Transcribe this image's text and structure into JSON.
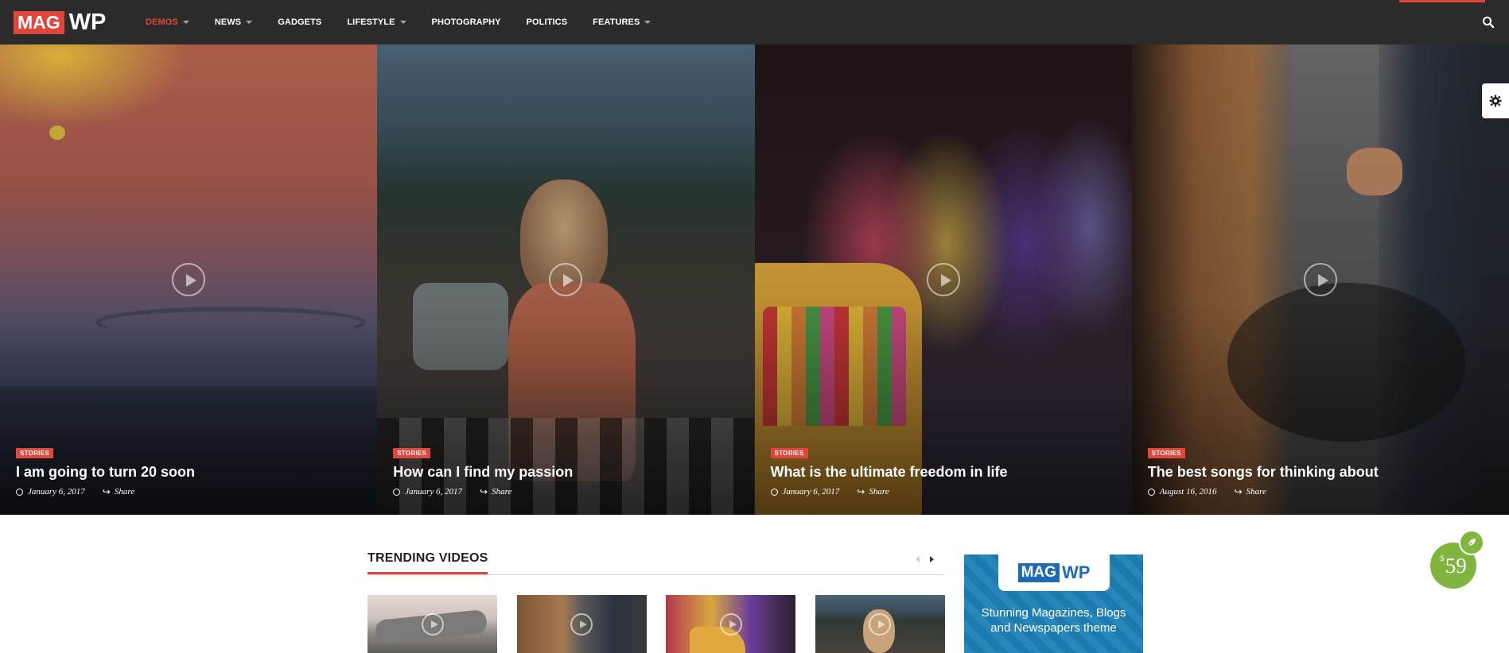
{
  "header": {
    "logo": {
      "part1": "MAG",
      "part2": "WP"
    },
    "nav": [
      {
        "label": "DEMOS",
        "dropdown": true,
        "active": true
      },
      {
        "label": "NEWS",
        "dropdown": true
      },
      {
        "label": "GADGETS",
        "dropdown": false
      },
      {
        "label": "LIFESTYLE",
        "dropdown": true
      },
      {
        "label": "PHOTOGRAPHY",
        "dropdown": false
      },
      {
        "label": "POLITICS",
        "dropdown": false
      },
      {
        "label": "FEATURES",
        "dropdown": true
      }
    ],
    "search_icon": "search-icon"
  },
  "hero": [
    {
      "category": "STORIES",
      "title": "I am going to turn 20 soon",
      "date": "January 6, 2017",
      "share": "Share"
    },
    {
      "category": "STORIES",
      "title": "How can I find my passion",
      "date": "January 6, 2017",
      "share": "Share"
    },
    {
      "category": "STORIES",
      "title": "What is the ultimate freedom in life",
      "date": "January 6, 2017",
      "share": "Share"
    },
    {
      "category": "STORIES",
      "title": "The best songs for thinking about",
      "date": "August 16, 2016",
      "share": "Share"
    }
  ],
  "trending": {
    "title": "TRENDING VIDEOS"
  },
  "ad": {
    "logo_part1": "MAG",
    "logo_part2": "WP",
    "line1": "Stunning Magazines, Blogs",
    "line2": "and Newspapers theme"
  },
  "price_badge": {
    "currency": "$",
    "amount": "59"
  },
  "colors": {
    "accent": "#e0473a",
    "header_bg": "#2b2b2b",
    "price_green": "#82b440",
    "ad_blue": "#1d7fb5"
  }
}
